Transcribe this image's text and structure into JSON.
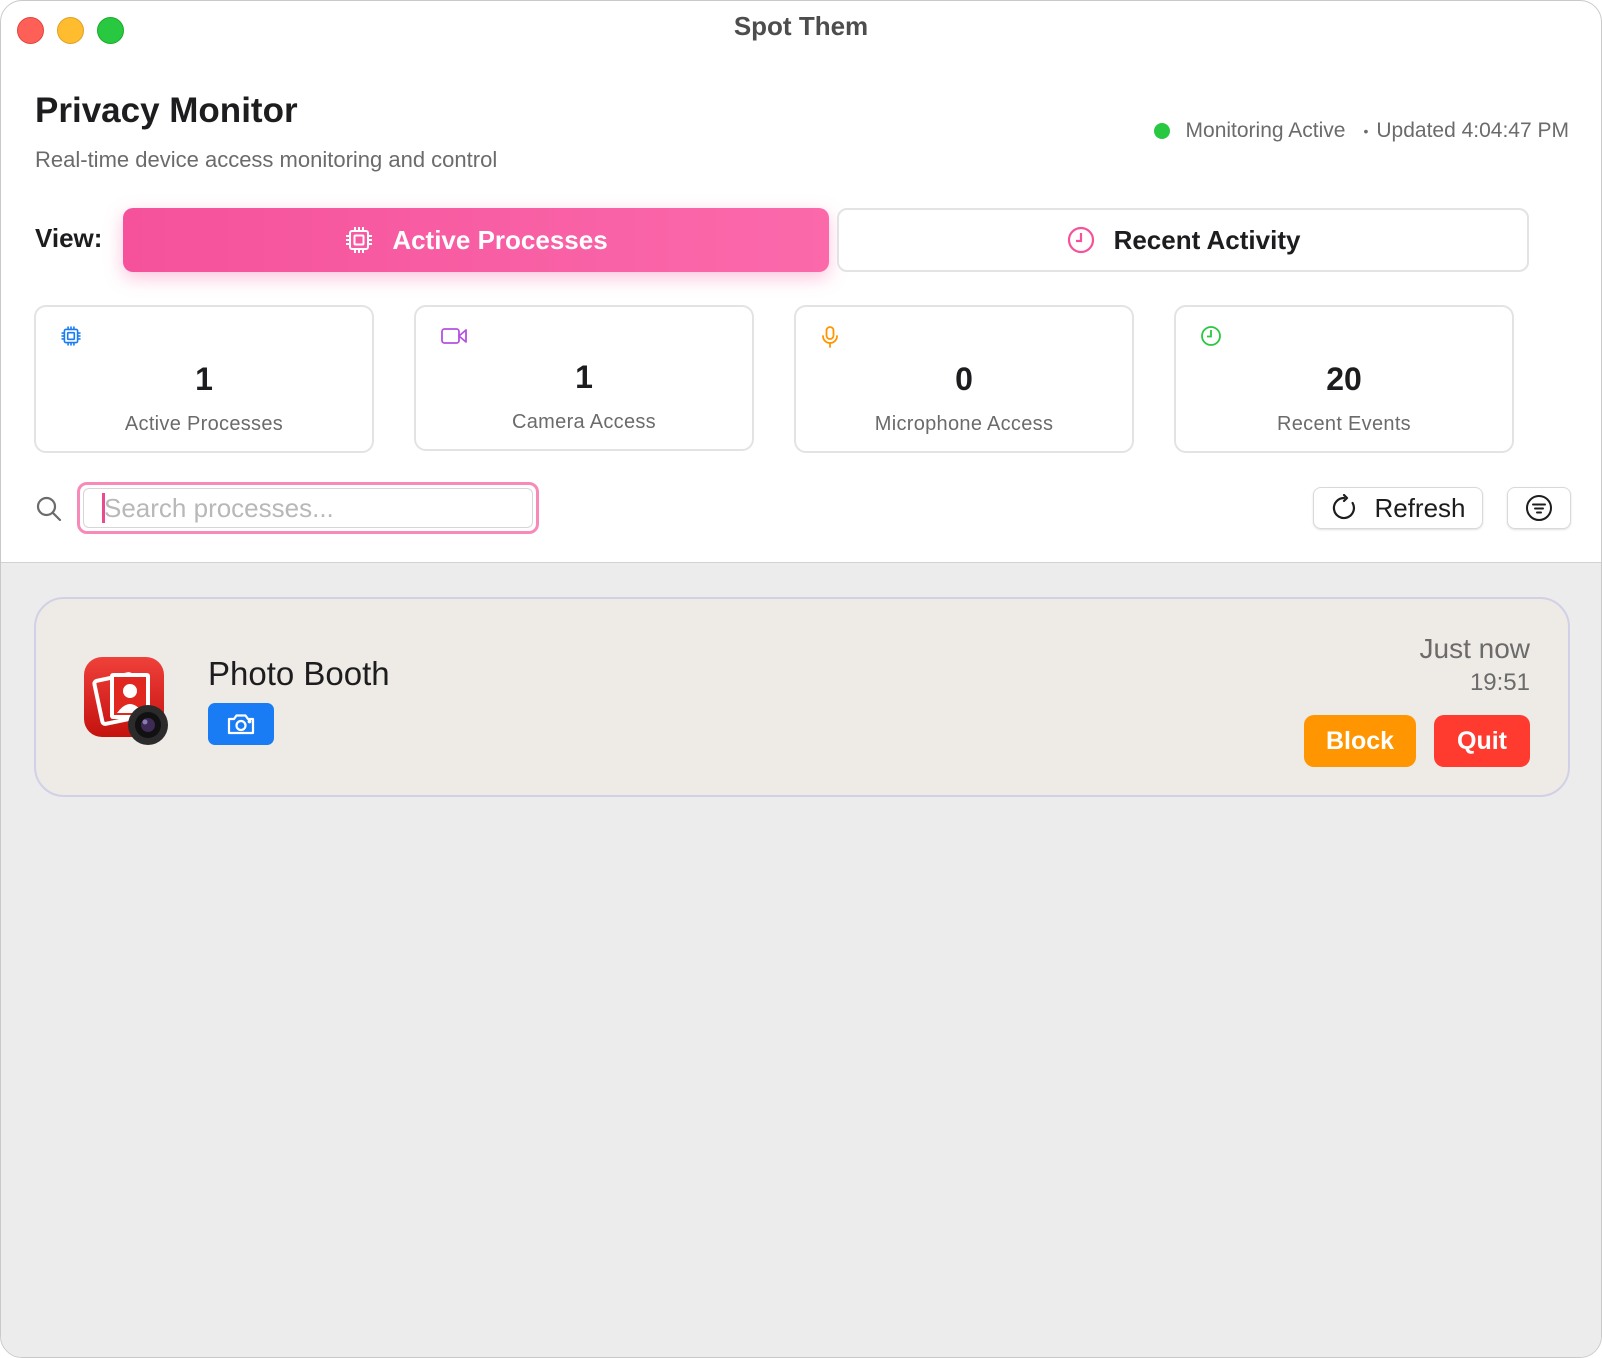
{
  "window": {
    "title": "Spot Them"
  },
  "header": {
    "title": "Privacy Monitor",
    "subtitle": "Real-time device access monitoring and control",
    "status": "Monitoring Active",
    "separator": "•",
    "updated": "Updated 4:04:47 PM"
  },
  "view": {
    "label": "View:",
    "tabs": [
      {
        "label": "Active Processes",
        "icon": "cpu-icon",
        "active": true
      },
      {
        "label": "Recent Activity",
        "icon": "clock-icon",
        "active": false
      }
    ]
  },
  "stats": [
    {
      "value": "1",
      "label": "Active Processes",
      "icon": "cpu-icon",
      "color": "#1a7cf5"
    },
    {
      "value": "1",
      "label": "Camera Access",
      "icon": "video-icon",
      "color": "#b452e0"
    },
    {
      "value": "0",
      "label": "Microphone Access",
      "icon": "microphone-icon",
      "color": "#ff9500"
    },
    {
      "value": "20",
      "label": "Recent Events",
      "icon": "clock-icon",
      "color": "#28c840"
    }
  ],
  "search": {
    "placeholder": "Search processes...",
    "value": ""
  },
  "toolbar": {
    "refresh_label": "Refresh"
  },
  "processes": [
    {
      "name": "Photo Booth",
      "access": "camera-icon",
      "time_relative": "Just now",
      "time": "19:51",
      "block_label": "Block",
      "quit_label": "Quit"
    }
  ],
  "colors": {
    "accent": "#f5529b",
    "status_active": "#28c840",
    "camera_badge": "#1a7cf5",
    "block": "#ff9500",
    "quit": "#ff3b30"
  }
}
